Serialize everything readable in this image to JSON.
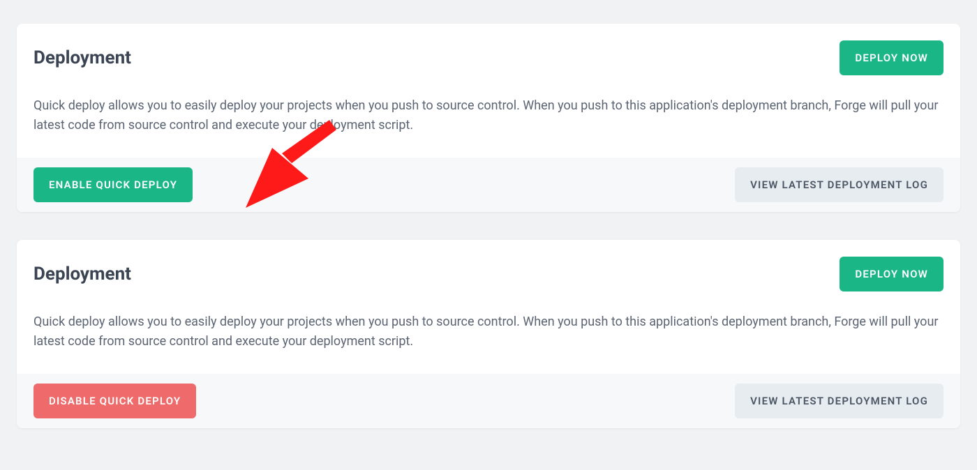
{
  "cards": [
    {
      "title": "Deployment",
      "deploy_now": "Deploy Now",
      "description": "Quick deploy allows you to easily deploy your projects when you push to source control. When you push to this application's deployment branch, Forge will pull your latest code from source control and execute your deployment script.",
      "action_label": "Enable Quick Deploy",
      "log_label": "View Latest Deployment Log"
    },
    {
      "title": "Deployment",
      "deploy_now": "Deploy Now",
      "description": "Quick deploy allows you to easily deploy your projects when you push to source control. When you push to this application's deployment branch, Forge will pull your latest code from source control and execute your deployment script.",
      "action_label": "Disable Quick Deploy",
      "log_label": "View Latest Deployment Log"
    }
  ],
  "colors": {
    "green": "#1bb686",
    "red": "#ef6a6a",
    "arrow": "#ff1a1a"
  }
}
